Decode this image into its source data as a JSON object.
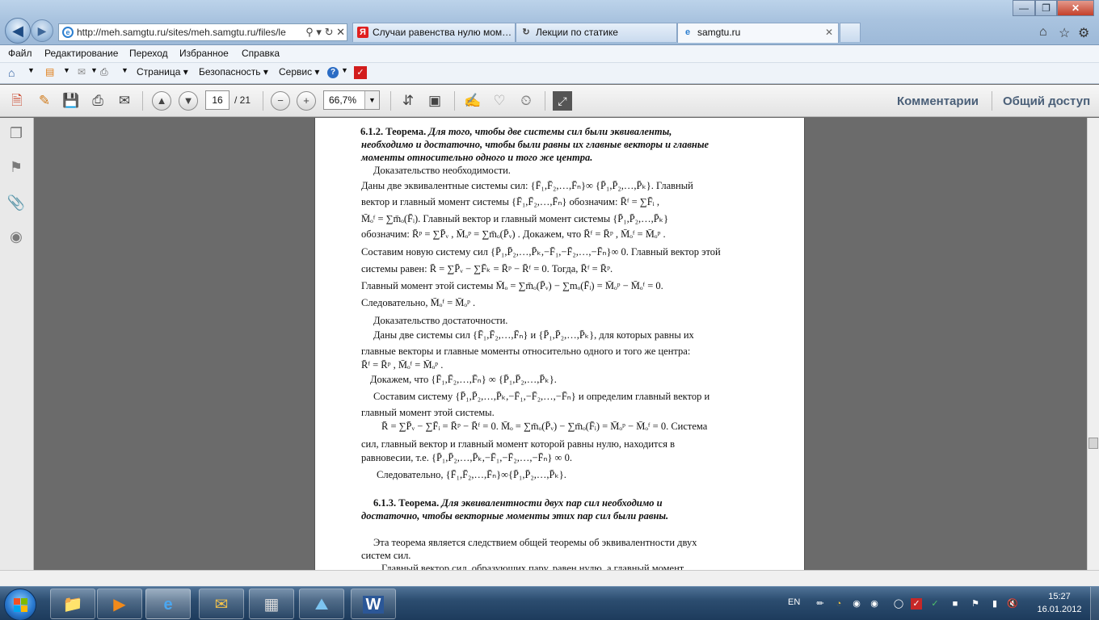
{
  "browser": {
    "address_url": "http://meh.samgtu.ru/sites/meh.samgtu.ru/files/le",
    "tabs": [
      {
        "title": "Случаи равенства нулю мом…",
        "icon": "yandex-icon"
      },
      {
        "title": "Лекции по статике",
        "icon": "loading-icon"
      },
      {
        "title": "samgtu.ru",
        "icon": "ie-icon"
      }
    ]
  },
  "menu": {
    "file": "Файл",
    "edit": "Редактирование",
    "go": "Переход",
    "favorites": "Избранное",
    "help": "Справка"
  },
  "commandbar": {
    "page": "Страница",
    "security": "Безопасность",
    "service": "Сервис"
  },
  "pdf_toolbar": {
    "current_page": "16",
    "total_pages": "/ 21",
    "zoom": "66,7%",
    "comments": "Комментарии",
    "share": "Общий доступ"
  },
  "document": {
    "lines": [
      {
        "parts": [
          {
            "t": "6.1.2. Теорема.",
            "s": "b"
          },
          {
            "t": " Для того, чтобы две системы сил были эквиваленты,",
            "s": "bi"
          }
        ]
      },
      {
        "parts": [
          {
            "t": "необходимо и достаточно, чтобы были равны их  главные векторы и главные",
            "s": "bi"
          }
        ]
      },
      {
        "parts": [
          {
            "t": "моменты относительно одного и того же центра.",
            "s": "bi"
          }
        ]
      },
      {
        "parts": [
          {
            "t": "Доказательство необходимости.",
            "s": ""
          }
        ]
      },
      {
        "parts": [
          {
            "t": "Даны две эквивалентные системы  сил: {F̄₁,F̄₂,…,F̄ₙ}∞ {P̄₁,P̄₂,…,P̄ₖ}.  Главный",
            "s": ""
          }
        ]
      },
      {
        "parts": [
          {
            "t": "вектор  и  главный  момент  системы   {F̄₁,F̄₂,…,F̄ₙ}    обозначим:    R̄ᶠ = ∑F̄ᵢ ,",
            "s": ""
          }
        ]
      },
      {
        "parts": [
          {
            "t": "M̄ₒᶠ = ∑m̄ₒ(F̄ᵢ).  Главный  вектор  и  главный  момент  системы  {P̄₁,P̄₂,…,P̄ₖ}",
            "s": ""
          }
        ]
      },
      {
        "parts": [
          {
            "t": "обозначим: R̄ᵖ = ∑P̄ᵥ ,  M̄ₒᵖ = ∑m̄ₒ(P̄ᵥ) .   Докажем, что  R̄ᶠ = R̄ᵖ ,   M̄ₒᶠ = M̄ₒᵖ .",
            "s": ""
          }
        ]
      },
      {
        "parts": [
          {
            "t": "Составим новую систему сил {P̄₁,P̄₂,…,P̄ₖ,−F̄₁,−F̄₂,…,−F̄ₙ}∞ 0. Главный вектор этой",
            "s": ""
          }
        ]
      },
      {
        "parts": [
          {
            "t": "системы равен: R̄ = ∑P̄ᵥ − ∑F̄ₖ = R̄ᵖ − R̄ᶠ = 0. Тогда, R̄ᶠ = R̄ᵖ.",
            "s": ""
          }
        ]
      },
      {
        "parts": [
          {
            "t": "Главный момент этой системы  M̄ₒ = ∑m̄ₒ(P̄ᵥ) − ∑mₒ(F̄ᵢ) = M̄ₒᵖ − M̄ₒᶠ = 0.",
            "s": ""
          }
        ]
      },
      {
        "parts": [
          {
            "t": "Следовательно,    M̄ₒᶠ = M̄ₒᵖ .",
            "s": ""
          }
        ]
      },
      {
        "parts": [
          {
            "t": "Доказательство достаточности.",
            "s": ""
          }
        ]
      },
      {
        "parts": [
          {
            "t": "Даны две системы  сил  {F̄₁,F̄₂,…,F̄ₙ} и {P̄₁,P̄₂,…,P̄ₖ},  для  которых равны их",
            "s": ""
          }
        ]
      },
      {
        "parts": [
          {
            "t": "главные векторы и главные моменты относительно одного и того же центра:",
            "s": ""
          }
        ]
      },
      {
        "parts": [
          {
            "t": "R̄ᶠ = R̄ᵖ ,     M̄ₒᶠ = M̄ₒᵖ .",
            "s": ""
          }
        ]
      },
      {
        "parts": [
          {
            "t": "Докажем, что {F̄₁,F̄₂,…,F̄ₙ} ∞  {P̄₁,P̄₂,…,P̄ₖ}.",
            "s": ""
          }
        ]
      },
      {
        "parts": [
          {
            "t": "Составим  систему  {P̄₁,P̄₂,…,P̄ₖ,−F̄₁,−F̄₂,…,−F̄ₙ} и определим главный    вектор и",
            "s": ""
          }
        ]
      },
      {
        "parts": [
          {
            "t": "главный момент этой системы.",
            "s": ""
          }
        ]
      },
      {
        "parts": [
          {
            "t": "R̄ = ∑P̄ᵥ − ∑F̄ᵢ = R̄ᵖ − R̄ᶠ = 0.      M̄ₒ = ∑m̄ₒ(P̄ᵥ) − ∑m̄ₒ(F̄ᵢ) = M̄ₒᵖ − M̄ₒᶠ = 0. Система",
            "s": ""
          }
        ]
      },
      {
        "parts": [
          {
            "t": "сил,  главный  вектор  и  главный  момент  которой  равны  нулю,  находится  в",
            "s": ""
          }
        ]
      },
      {
        "parts": [
          {
            "t": "равновесии, т.е.  {P̄₁,P̄₂,…,P̄ₖ,−F̄₁,−F̄₂,…,−F̄ₙ} ∞  0.",
            "s": ""
          }
        ]
      },
      {
        "parts": [
          {
            "t": "Следовательно, {F̄₁,F̄₂,…,F̄ₙ}∞{P̄₁,P̄₂,…,P̄ₖ}.",
            "s": ""
          }
        ]
      },
      {
        "parts": [
          {
            "t": "6.1.3. Теорема.",
            "s": "b"
          },
          {
            "t": " Для эквивалентности двух пар сил необходимо и",
            "s": "bi"
          }
        ]
      },
      {
        "parts": [
          {
            "t": "достаточно, чтобы векторные моменты этих пар  сил были равны.",
            "s": "bi"
          }
        ]
      },
      {
        "parts": [
          {
            "t": "Эта теорема является следствием общей теоремы об эквивалентности двух",
            "s": ""
          }
        ]
      },
      {
        "parts": [
          {
            "t": "систем сил.",
            "s": ""
          }
        ]
      },
      {
        "parts": [
          {
            "t": "Главный  вектор  сил,  образующих  пару,  равен  нулю,  а  главный  момент",
            "s": ""
          }
        ]
      }
    ]
  },
  "taskbar": {
    "lang": "EN",
    "time": "15:27",
    "date": "16.01.2012"
  }
}
